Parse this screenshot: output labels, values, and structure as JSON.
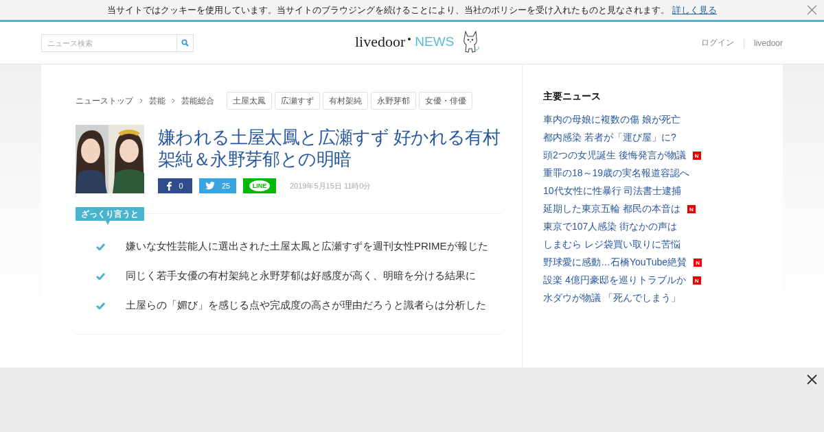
{
  "cookie_bar": {
    "message": "当サイトではクッキーを使用しています。当サイトのブラウジングを続けることにより、当社のポリシーを受け入れたものと見なされます。",
    "link": "詳しく見る"
  },
  "header": {
    "search": {
      "placeholder": "ニュース検索"
    },
    "logo": {
      "name": "livedoor",
      "section": "NEWS"
    },
    "nav": [
      "ログイン",
      "livedoor"
    ]
  },
  "breadcrumbs": [
    "ニューストップ",
    "芸能",
    "芸能総合"
  ],
  "tags": [
    "土屋太鳳",
    "広瀬すず",
    "有村架純",
    "永野芽郁",
    "女優・俳優"
  ],
  "article": {
    "title": "嫌われる土屋太鳳と広瀬すず 好かれる有村架純＆永野芽郁との明暗",
    "share": [
      {
        "kind": "facebook",
        "count": "0"
      },
      {
        "kind": "twitter",
        "count": "25"
      },
      {
        "kind": "line",
        "label": "LINE"
      }
    ],
    "date": "2019年5月15日 11時0分"
  },
  "summary": {
    "label": "ざっくり言うと",
    "points": [
      "嫌いな女性芸能人に選出された土屋太鳳と広瀬すずを週刊女性PRIMEが報じた",
      "同じく若手女優の有村架純と永野芽郁は好感度が高く、明暗を分ける結果に",
      "土屋らの「媚び」を感じる点や完成度の高さが理由だろうと識者らは分析した"
    ]
  },
  "sidebar": {
    "title": "主要ニュース",
    "items": [
      {
        "text": "車内の母娘に複数の傷 娘が死亡"
      },
      {
        "text": "都内感染 若者が「運び屋」に?"
      },
      {
        "text": "頭2つの女児誕生 後悔発言が物議",
        "badge": "N"
      },
      {
        "text": "重罪の18～19歳の実名報道容認へ"
      },
      {
        "text": "10代女性に性暴行 司法書士逮捕"
      },
      {
        "text": "延期した東京五輪 都民の本音は",
        "badge": "N"
      },
      {
        "text": "東京で107人感染 街なかの声は"
      },
      {
        "text": "しまむら レジ袋買い取りに苦悩"
      },
      {
        "text": "野球愛に感動…石橋YouTube絶賛",
        "badge": "N"
      },
      {
        "text": "設楽 4億円豪邸を巡りトラブルか",
        "badge": "N"
      },
      {
        "text": "水ダウが物議 「死んでしまう」"
      }
    ]
  }
}
